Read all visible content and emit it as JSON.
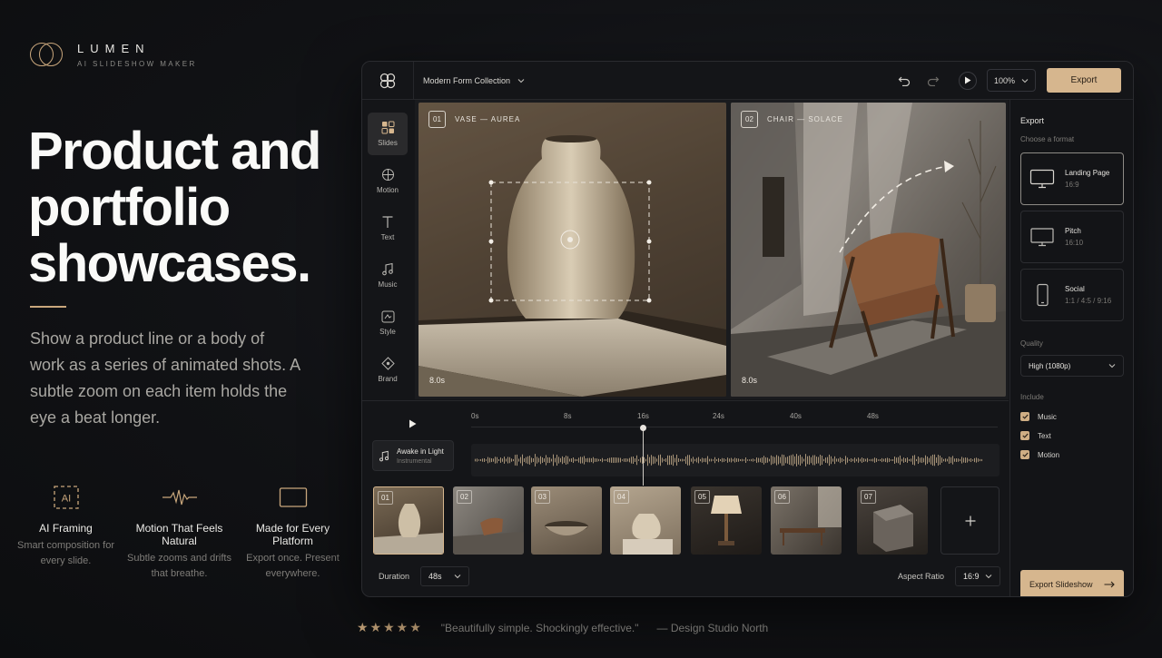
{
  "brand": {
    "name": "LUMEN",
    "tagline": "AI SLIDESHOW MAKER"
  },
  "hero": {
    "headline": "Product and portfolio showcases.",
    "subcopy": "Show a product line or a body of work as a series of animated shots. A subtle zoom on each item holds the eye a beat longer."
  },
  "features": [
    {
      "icon": "ai-frame-icon",
      "title": "AI Framing",
      "desc": "Smart composition for every slide."
    },
    {
      "icon": "pulse-wave-icon",
      "title": "Motion That Feels Natural",
      "desc": "Subtle zooms and drifts that breathe."
    },
    {
      "icon": "screen-frame-icon",
      "title": "Made for Every Platform",
      "desc": "Export once. Present everywhere."
    }
  ],
  "testimonial": {
    "stars": "★★★★★",
    "quote": "\"Beautifully simple. Shockingly effective.\"",
    "author": "— Design Studio North"
  },
  "app": {
    "project_name": "Modern Form Collection",
    "zoom": "100%",
    "export_label": "Export",
    "tools": [
      "Slides",
      "Motion",
      "Text",
      "Music",
      "Style",
      "Brand"
    ],
    "slides": [
      {
        "num": "01",
        "label": "VASE — AUREA",
        "duration": "8.0s"
      },
      {
        "num": "02",
        "label": "CHAIR — SOLACE",
        "duration": "8.0s"
      }
    ],
    "panel": {
      "title": "Export",
      "choose_format": "Choose a format",
      "formats": [
        {
          "name": "Landing Page",
          "ratio": "16:9"
        },
        {
          "name": "Pitch",
          "ratio": "16:10"
        },
        {
          "name": "Social",
          "ratio": "1:1 / 4:5 / 9:16"
        }
      ],
      "quality_label": "Quality",
      "quality_value": "High (1080p)",
      "include_label": "Include",
      "include_items": [
        "Music",
        "Text",
        "Motion"
      ],
      "export_slideshow": "Export Slideshow"
    },
    "timeline": {
      "ticks": [
        "0s",
        "8s",
        "16s",
        "24s",
        "40s",
        "48s"
      ],
      "audio_title": "Awake in Light",
      "audio_sub": "Instrumental",
      "thumbs": [
        "01",
        "02",
        "03",
        "04",
        "05",
        "06",
        "07"
      ],
      "duration_label": "Duration",
      "duration_value": "48s",
      "aspect_label": "Aspect Ratio",
      "aspect_value": "16:9"
    }
  },
  "colors": {
    "accent": "#d6b68e",
    "background": "#111215",
    "panel": "#141518"
  }
}
